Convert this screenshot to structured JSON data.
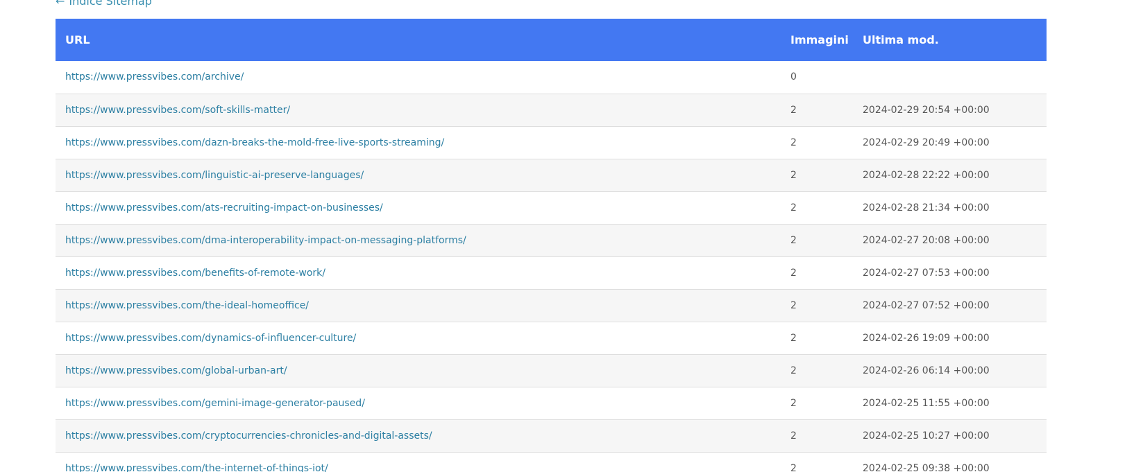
{
  "back_link": {
    "arrow": "←",
    "label": "Indice Sitemap"
  },
  "table": {
    "headers": {
      "url": "URL",
      "images": "Immagini",
      "last_mod": "Ultima mod."
    },
    "rows": [
      {
        "url": "https://www.pressvibes.com/archive/",
        "images": "0",
        "last_mod": ""
      },
      {
        "url": "https://www.pressvibes.com/soft-skills-matter/",
        "images": "2",
        "last_mod": "2024-02-29 20:54 +00:00"
      },
      {
        "url": "https://www.pressvibes.com/dazn-breaks-the-mold-free-live-sports-streaming/",
        "images": "2",
        "last_mod": "2024-02-29 20:49 +00:00"
      },
      {
        "url": "https://www.pressvibes.com/linguistic-ai-preserve-languages/",
        "images": "2",
        "last_mod": "2024-02-28 22:22 +00:00"
      },
      {
        "url": "https://www.pressvibes.com/ats-recruiting-impact-on-businesses/",
        "images": "2",
        "last_mod": "2024-02-28 21:34 +00:00"
      },
      {
        "url": "https://www.pressvibes.com/dma-interoperability-impact-on-messaging-platforms/",
        "images": "2",
        "last_mod": "2024-02-27 20:08 +00:00"
      },
      {
        "url": "https://www.pressvibes.com/benefits-of-remote-work/",
        "images": "2",
        "last_mod": "2024-02-27 07:53 +00:00"
      },
      {
        "url": "https://www.pressvibes.com/the-ideal-homeoffice/",
        "images": "2",
        "last_mod": "2024-02-27 07:52 +00:00"
      },
      {
        "url": "https://www.pressvibes.com/dynamics-of-influencer-culture/",
        "images": "2",
        "last_mod": "2024-02-26 19:09 +00:00"
      },
      {
        "url": "https://www.pressvibes.com/global-urban-art/",
        "images": "2",
        "last_mod": "2024-02-26 06:14 +00:00"
      },
      {
        "url": "https://www.pressvibes.com/gemini-image-generator-paused/",
        "images": "2",
        "last_mod": "2024-02-25 11:55 +00:00"
      },
      {
        "url": "https://www.pressvibes.com/cryptocurrencies-chronicles-and-digital-assets/",
        "images": "2",
        "last_mod": "2024-02-25 10:27 +00:00"
      },
      {
        "url": "https://www.pressvibes.com/the-internet-of-things-iot/",
        "images": "2",
        "last_mod": "2024-02-25 09:38 +00:00"
      }
    ]
  },
  "colors": {
    "header_bg": "#4378f2",
    "link": "#2c7fa3",
    "row_alt": "#f6f6f6"
  }
}
